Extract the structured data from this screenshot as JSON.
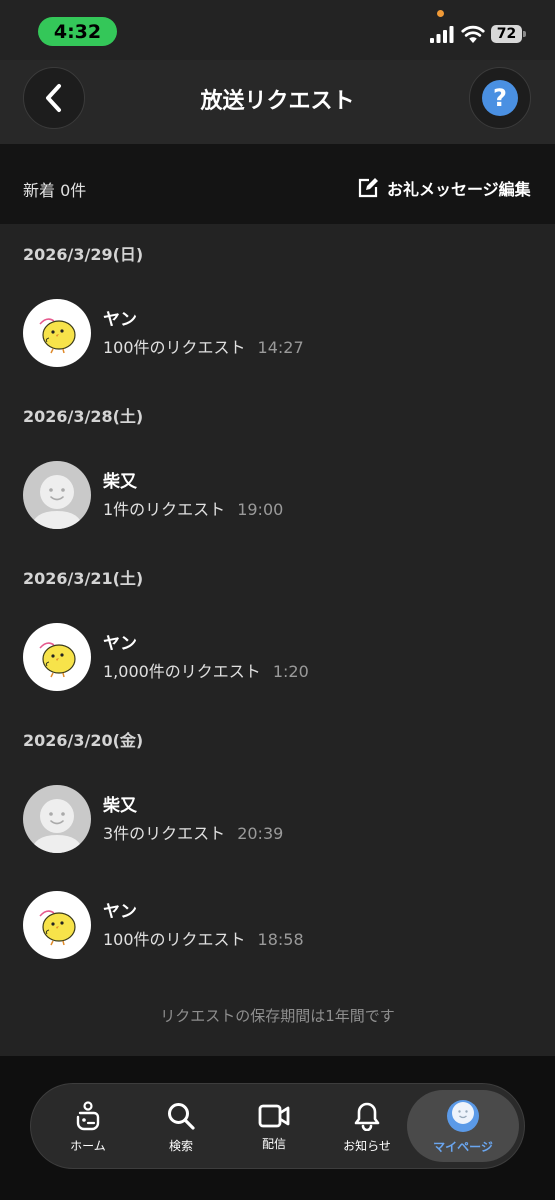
{
  "status_bar": {
    "time": "4:32",
    "battery": "72"
  },
  "header": {
    "title": "放送リクエスト"
  },
  "count_bar": {
    "new_count": "新着 0件",
    "thanks_label": "お礼メッセージ編集"
  },
  "groups": [
    {
      "date": "2026/3/29(日)",
      "items": [
        {
          "name": "ヤン",
          "detail": "100件のリクエスト",
          "time": "14:27",
          "avatar": "chick-avatar"
        }
      ]
    },
    {
      "date": "2026/3/28(土)",
      "items": [
        {
          "name": "柴又",
          "detail": "1件のリクエスト",
          "time": "19:00",
          "avatar": "default-avatar"
        }
      ]
    },
    {
      "date": "2026/3/21(土)",
      "items": [
        {
          "name": "ヤン",
          "detail": "1,000件のリクエスト",
          "time": "1:20",
          "avatar": "chick-avatar"
        }
      ]
    },
    {
      "date": "2026/3/20(金)",
      "items": [
        {
          "name": "柴又",
          "detail": "3件のリクエスト",
          "time": "20:39",
          "avatar": "default-avatar"
        },
        {
          "name": "ヤン",
          "detail": "100件のリクエスト",
          "time": "18:58",
          "avatar": "chick-avatar"
        }
      ]
    }
  ],
  "footer_note": "リクエストの保存期間は1年間です",
  "tabs": [
    {
      "label": "ホーム",
      "icon": "home-icon"
    },
    {
      "label": "検索",
      "icon": "search-icon"
    },
    {
      "label": "配信",
      "icon": "video-camera-icon"
    },
    {
      "label": "お知らせ",
      "icon": "bell-icon"
    },
    {
      "label": "マイページ",
      "icon": "avatar-icon",
      "active": true
    }
  ],
  "colors": {
    "accent": "#4a90e2",
    "status_green": "#34c759",
    "active_tab_text": "#6aa6f0"
  }
}
